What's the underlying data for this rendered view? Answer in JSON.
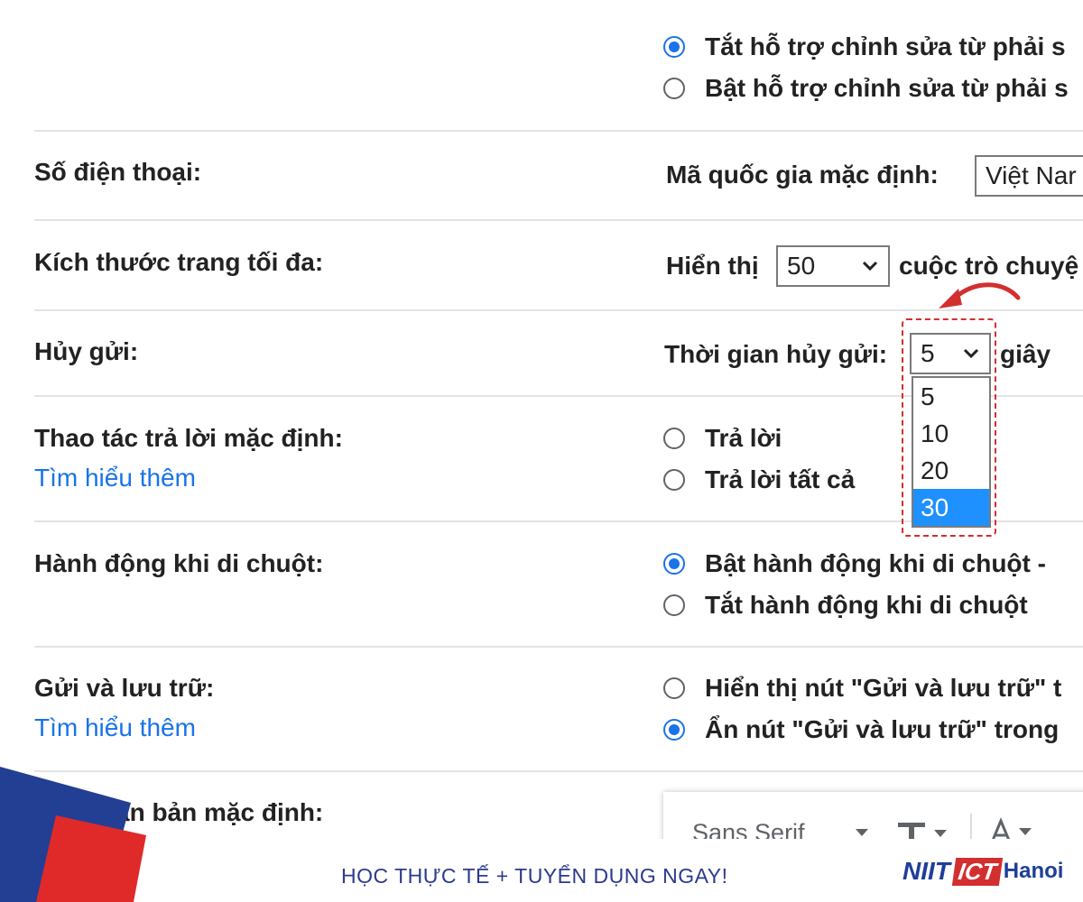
{
  "rtl": {
    "option_off": "Tắt hỗ trợ chỉnh sửa từ phải s",
    "option_on": "Bật hỗ trợ chỉnh sửa từ phải s",
    "selected": "off"
  },
  "phone": {
    "label": "Số điện thoại:",
    "country_label": "Mã quốc gia mặc định:",
    "country_value": "Việt Nar"
  },
  "page_size": {
    "label": "Kích thước trang tối đa:",
    "prefix": "Hiển thị",
    "value": "50",
    "suffix": "cuộc trò chuyệ"
  },
  "undo_send": {
    "label": "Hủy gửi:",
    "period_label": "Thời gian hủy gửi:",
    "value": "5",
    "unit": "giây",
    "options": [
      "5",
      "10",
      "20",
      "30"
    ],
    "highlighted_option": "30"
  },
  "reply": {
    "label": "Thao tác trả lời mặc định:",
    "learn_more": "Tìm hiểu thêm",
    "option_reply": "Trả lời",
    "option_reply_all": "Trả lời tất cả"
  },
  "hover": {
    "label": "Hành động khi di chuột:",
    "option_on": "Bật hành động khi di chuột -",
    "option_off": "Tắt hành động khi di chuột",
    "selected": "on"
  },
  "send_archive": {
    "label": "Gửi và lưu trữ:",
    "learn_more": "Tìm hiểu thêm",
    "option_show": "Hiển thị nút \"Gửi và lưu trữ\" t",
    "option_hide": "Ẩn nút \"Gửi và lưu trữ\" trong",
    "selected": "hide"
  },
  "default_text": {
    "label": "ăn bản mặc định:",
    "font": "Sans Serif",
    "size_icon": "text-size-icon",
    "color_icon": "text-color-icon"
  },
  "footer": {
    "slogan": "HỌC THỰC TẾ + TUYỂN DỤNG NGAY!",
    "logo_niit": "NIIT",
    "logo_ict": "ICT",
    "logo_hanoi": "Hanoi"
  },
  "colors": {
    "accent": "#1a73e8",
    "highlight_red": "#d32f2f",
    "selected_option": "#1e90ff",
    "brand_blue": "#1f3e9a"
  }
}
